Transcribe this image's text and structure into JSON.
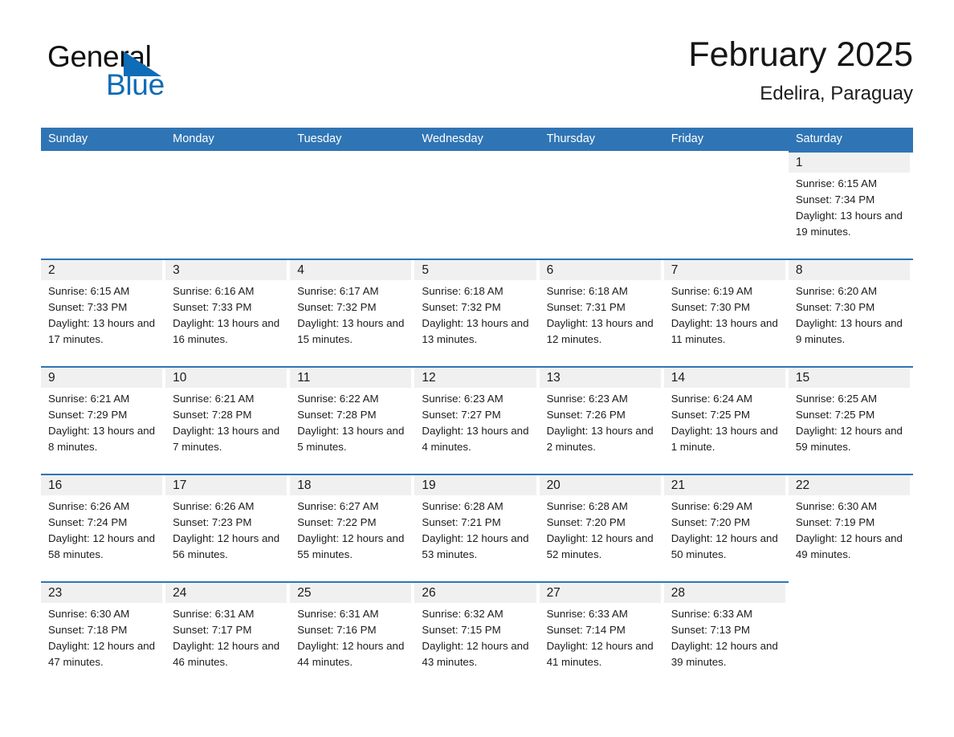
{
  "logo": {
    "word_one": "General",
    "word_two": "Blue",
    "sail_icon": "triangle-sail-icon",
    "brand_blue": "#0f6cb6"
  },
  "header": {
    "month_title": "February 2025",
    "location": "Edelira, Paraguay"
  },
  "theme": {
    "header_blue": "#2f75b5",
    "row_border_blue": "#2f75b5",
    "day_number_band": "#f0f0f0"
  },
  "calendar": {
    "weekdays": [
      "Sunday",
      "Monday",
      "Tuesday",
      "Wednesday",
      "Thursday",
      "Friday",
      "Saturday"
    ],
    "weeks": [
      [
        {
          "day": "",
          "empty": true
        },
        {
          "day": "",
          "empty": true
        },
        {
          "day": "",
          "empty": true
        },
        {
          "day": "",
          "empty": true
        },
        {
          "day": "",
          "empty": true
        },
        {
          "day": "",
          "empty": true
        },
        {
          "day": "1",
          "sunrise": "Sunrise: 6:15 AM",
          "sunset": "Sunset: 7:34 PM",
          "daylight": "Daylight: 13 hours and 19 minutes."
        }
      ],
      [
        {
          "day": "2",
          "sunrise": "Sunrise: 6:15 AM",
          "sunset": "Sunset: 7:33 PM",
          "daylight": "Daylight: 13 hours and 17 minutes."
        },
        {
          "day": "3",
          "sunrise": "Sunrise: 6:16 AM",
          "sunset": "Sunset: 7:33 PM",
          "daylight": "Daylight: 13 hours and 16 minutes."
        },
        {
          "day": "4",
          "sunrise": "Sunrise: 6:17 AM",
          "sunset": "Sunset: 7:32 PM",
          "daylight": "Daylight: 13 hours and 15 minutes."
        },
        {
          "day": "5",
          "sunrise": "Sunrise: 6:18 AM",
          "sunset": "Sunset: 7:32 PM",
          "daylight": "Daylight: 13 hours and 13 minutes."
        },
        {
          "day": "6",
          "sunrise": "Sunrise: 6:18 AM",
          "sunset": "Sunset: 7:31 PM",
          "daylight": "Daylight: 13 hours and 12 minutes."
        },
        {
          "day": "7",
          "sunrise": "Sunrise: 6:19 AM",
          "sunset": "Sunset: 7:30 PM",
          "daylight": "Daylight: 13 hours and 11 minutes."
        },
        {
          "day": "8",
          "sunrise": "Sunrise: 6:20 AM",
          "sunset": "Sunset: 7:30 PM",
          "daylight": "Daylight: 13 hours and 9 minutes."
        }
      ],
      [
        {
          "day": "9",
          "sunrise": "Sunrise: 6:21 AM",
          "sunset": "Sunset: 7:29 PM",
          "daylight": "Daylight: 13 hours and 8 minutes."
        },
        {
          "day": "10",
          "sunrise": "Sunrise: 6:21 AM",
          "sunset": "Sunset: 7:28 PM",
          "daylight": "Daylight: 13 hours and 7 minutes."
        },
        {
          "day": "11",
          "sunrise": "Sunrise: 6:22 AM",
          "sunset": "Sunset: 7:28 PM",
          "daylight": "Daylight: 13 hours and 5 minutes."
        },
        {
          "day": "12",
          "sunrise": "Sunrise: 6:23 AM",
          "sunset": "Sunset: 7:27 PM",
          "daylight": "Daylight: 13 hours and 4 minutes."
        },
        {
          "day": "13",
          "sunrise": "Sunrise: 6:23 AM",
          "sunset": "Sunset: 7:26 PM",
          "daylight": "Daylight: 13 hours and 2 minutes."
        },
        {
          "day": "14",
          "sunrise": "Sunrise: 6:24 AM",
          "sunset": "Sunset: 7:25 PM",
          "daylight": "Daylight: 13 hours and 1 minute."
        },
        {
          "day": "15",
          "sunrise": "Sunrise: 6:25 AM",
          "sunset": "Sunset: 7:25 PM",
          "daylight": "Daylight: 12 hours and 59 minutes."
        }
      ],
      [
        {
          "day": "16",
          "sunrise": "Sunrise: 6:26 AM",
          "sunset": "Sunset: 7:24 PM",
          "daylight": "Daylight: 12 hours and 58 minutes."
        },
        {
          "day": "17",
          "sunrise": "Sunrise: 6:26 AM",
          "sunset": "Sunset: 7:23 PM",
          "daylight": "Daylight: 12 hours and 56 minutes."
        },
        {
          "day": "18",
          "sunrise": "Sunrise: 6:27 AM",
          "sunset": "Sunset: 7:22 PM",
          "daylight": "Daylight: 12 hours and 55 minutes."
        },
        {
          "day": "19",
          "sunrise": "Sunrise: 6:28 AM",
          "sunset": "Sunset: 7:21 PM",
          "daylight": "Daylight: 12 hours and 53 minutes."
        },
        {
          "day": "20",
          "sunrise": "Sunrise: 6:28 AM",
          "sunset": "Sunset: 7:20 PM",
          "daylight": "Daylight: 12 hours and 52 minutes."
        },
        {
          "day": "21",
          "sunrise": "Sunrise: 6:29 AM",
          "sunset": "Sunset: 7:20 PM",
          "daylight": "Daylight: 12 hours and 50 minutes."
        },
        {
          "day": "22",
          "sunrise": "Sunrise: 6:30 AM",
          "sunset": "Sunset: 7:19 PM",
          "daylight": "Daylight: 12 hours and 49 minutes."
        }
      ],
      [
        {
          "day": "23",
          "sunrise": "Sunrise: 6:30 AM",
          "sunset": "Sunset: 7:18 PM",
          "daylight": "Daylight: 12 hours and 47 minutes."
        },
        {
          "day": "24",
          "sunrise": "Sunrise: 6:31 AM",
          "sunset": "Sunset: 7:17 PM",
          "daylight": "Daylight: 12 hours and 46 minutes."
        },
        {
          "day": "25",
          "sunrise": "Sunrise: 6:31 AM",
          "sunset": "Sunset: 7:16 PM",
          "daylight": "Daylight: 12 hours and 44 minutes."
        },
        {
          "day": "26",
          "sunrise": "Sunrise: 6:32 AM",
          "sunset": "Sunset: 7:15 PM",
          "daylight": "Daylight: 12 hours and 43 minutes."
        },
        {
          "day": "27",
          "sunrise": "Sunrise: 6:33 AM",
          "sunset": "Sunset: 7:14 PM",
          "daylight": "Daylight: 12 hours and 41 minutes."
        },
        {
          "day": "28",
          "sunrise": "Sunrise: 6:33 AM",
          "sunset": "Sunset: 7:13 PM",
          "daylight": "Daylight: 12 hours and 39 minutes."
        },
        {
          "day": "",
          "empty": true
        }
      ]
    ]
  }
}
